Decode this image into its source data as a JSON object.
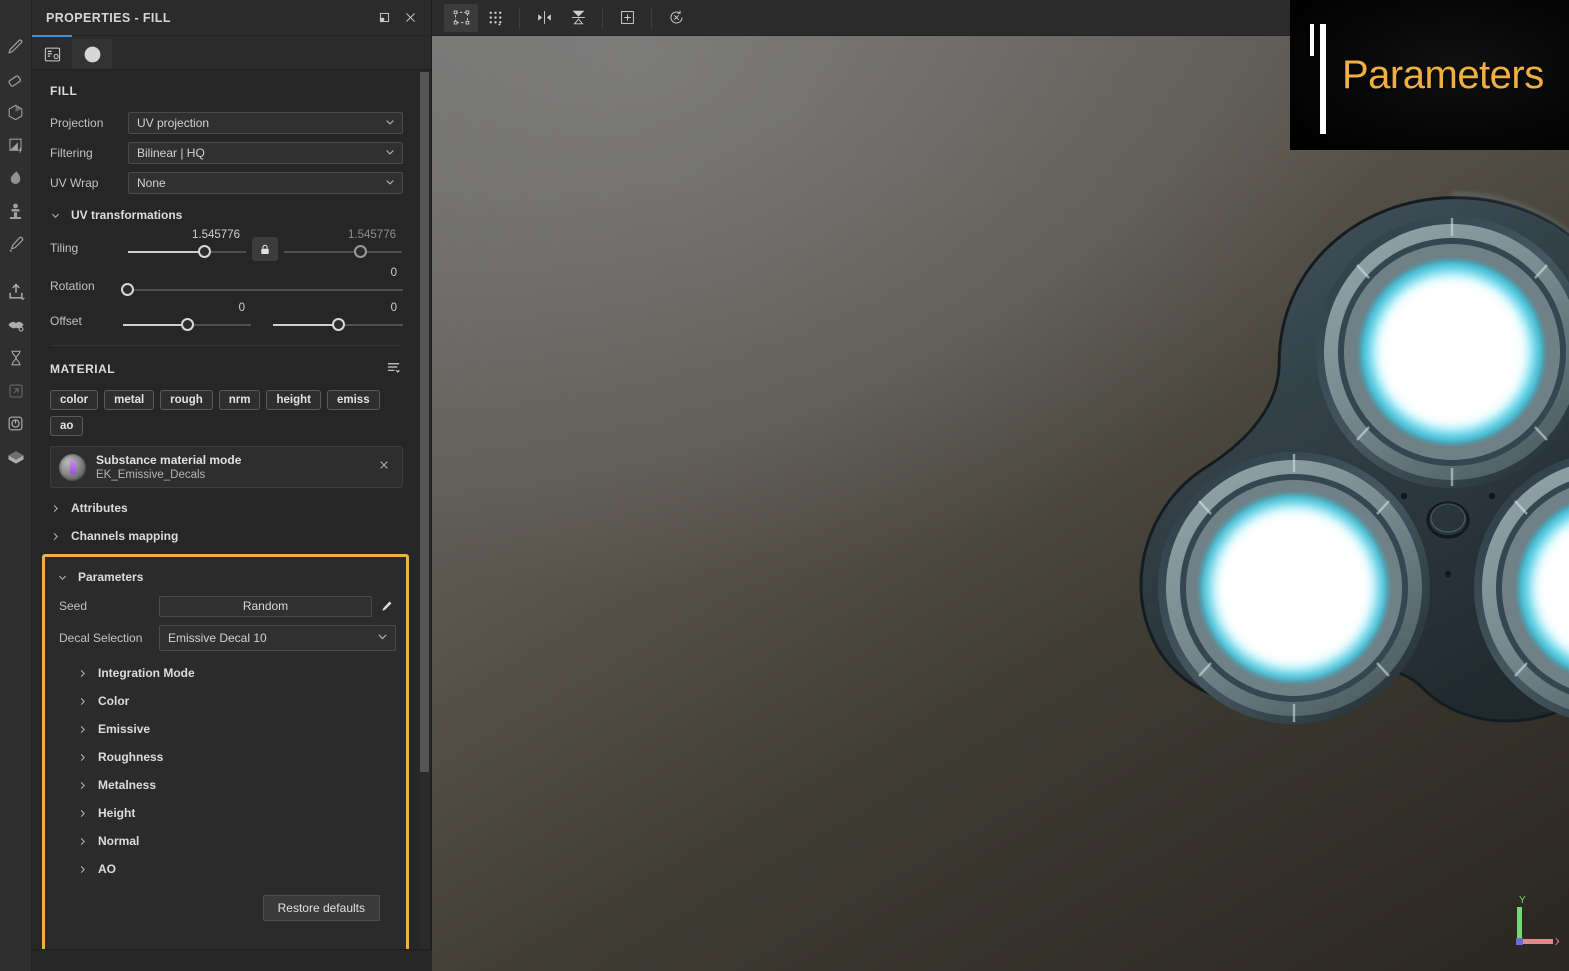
{
  "panel": {
    "title": "PROPERTIES - FILL",
    "title_buttons": [
      {
        "name": "restore-window-button",
        "icon": "restore-icon"
      },
      {
        "name": "close-panel-button",
        "icon": "close-icon"
      }
    ],
    "tabs": [
      {
        "label": "",
        "icon": "properties-list-icon",
        "active": false
      },
      {
        "label": "",
        "icon": "material-sphere-icon",
        "active": true
      }
    ]
  },
  "fill": {
    "heading": "FILL",
    "fields": [
      {
        "label": "Projection",
        "value": "UV projection",
        "name": "projection"
      },
      {
        "label": "Filtering",
        "value": "Bilinear  | HQ",
        "name": "filtering"
      },
      {
        "label": "UV Wrap",
        "value": "None",
        "name": "uv-wrap"
      }
    ],
    "uv_transformations": {
      "label": "UV transformations",
      "expanded": true,
      "tiling": {
        "label": "Tiling",
        "value_left": "1.545776",
        "value_right": "1.545776",
        "locked": true,
        "pos_left": 0.64,
        "pos_right": 0.64
      },
      "rotation": {
        "label": "Rotation",
        "value": "0",
        "pos": 0.02
      },
      "offset": {
        "label": "Offset",
        "value_left": "0",
        "value_right": "0",
        "pos_left": 0.5,
        "pos_right": 0.5
      }
    }
  },
  "material": {
    "heading": "MATERIAL",
    "channels": [
      "color",
      "metal",
      "rough",
      "nrm",
      "height",
      "emiss",
      "ao"
    ],
    "card": {
      "title": "Substance material mode",
      "subtitle": "EK_Emissive_Decals",
      "close": "×"
    },
    "groups": [
      {
        "label": "Attributes",
        "expanded": false
      },
      {
        "label": "Channels mapping",
        "expanded": false
      }
    ]
  },
  "parameters": {
    "label": "Parameters",
    "expanded": true,
    "highlighted": true,
    "highlight_color": "#f0b041",
    "seed": {
      "label": "Seed",
      "value": "Random"
    },
    "decal_selection": {
      "label": "Decal Selection",
      "value": "Emissive Decal  10"
    },
    "groups": [
      "Integration Mode",
      "Color",
      "Emissive",
      "Roughness",
      "Metalness",
      "Height",
      "Normal",
      "AO"
    ],
    "restore_defaults": "Restore defaults"
  },
  "toolrail": [
    {
      "name": "brush-tool",
      "icon": "brush-icon",
      "dim": false
    },
    {
      "name": "eraser-tool",
      "icon": "eraser-icon",
      "dim": false
    },
    {
      "name": "projection-tool",
      "icon": "cube-projection-icon",
      "dim": false
    },
    {
      "name": "polygon-fill-tool",
      "icon": "polygon-fill-icon",
      "dim": false
    },
    {
      "name": "smudge-tool",
      "icon": "smudge-icon",
      "dim": false
    },
    {
      "name": "clone-tool",
      "icon": "clone-stamp-icon",
      "dim": false
    },
    {
      "name": "pick-color-tool",
      "icon": "eyedropper-icon",
      "dim": false
    },
    {
      "name": "export-tool",
      "icon": "export-icon",
      "dim": false
    },
    {
      "name": "bake-tool",
      "icon": "bake-mesh-maps-icon",
      "dim": false
    },
    {
      "name": "baking-queue-tool",
      "icon": "hourglass-icon",
      "dim": false
    },
    {
      "name": "resource-link-tool",
      "icon": "resize-arrow-icon",
      "dim": true
    },
    {
      "name": "iray-render-tool",
      "icon": "iray-render-icon",
      "dim": false
    },
    {
      "name": "asset-box-tool",
      "icon": "open-box-icon",
      "dim": false
    }
  ],
  "viewport_toolbar": [
    {
      "name": "selection-mode-button",
      "icon": "selection-bounds-icon",
      "active": true
    },
    {
      "name": "uv-grid-button",
      "icon": "dot-grid-icon",
      "active": false
    },
    {
      "name": "symmetry-button",
      "icon": "mirror-symmetry-icon",
      "active": false
    },
    {
      "name": "flatten-button",
      "icon": "projection-plane-icon",
      "active": false
    },
    {
      "name": "add-camera-button",
      "icon": "add-frame-icon",
      "active": false
    },
    {
      "name": "reset-camera-button",
      "icon": "reset-circle-icon",
      "active": false
    }
  ],
  "callout": {
    "text": "Parameters",
    "color": "#f0b041"
  },
  "gizmo": {
    "axes": [
      {
        "label": "Y",
        "color": "#7ad67a"
      },
      {
        "label": "X",
        "color": "#e08a8a"
      }
    ]
  }
}
